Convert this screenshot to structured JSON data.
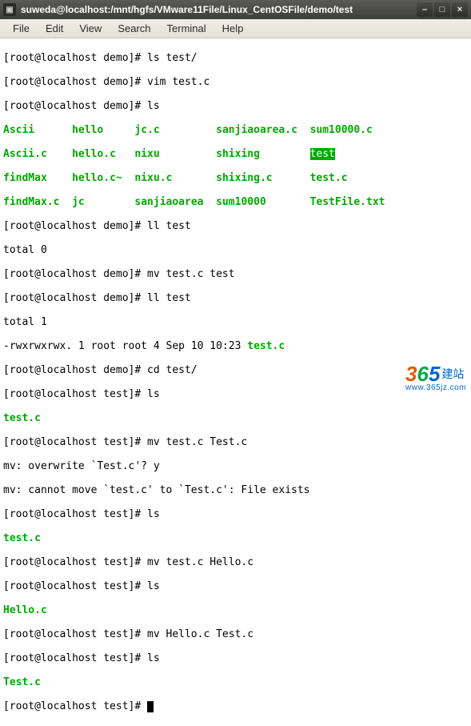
{
  "window": {
    "title": "suweda@localhost:/mnt/hgfs/VMware11File/Linux_CentOSFile/demo/test"
  },
  "menubar": {
    "items": [
      "File",
      "Edit",
      "View",
      "Search",
      "Terminal",
      "Help"
    ]
  },
  "term": {
    "p_demo": "[root@localhost demo]#",
    "p_test": "[root@localhost test]#",
    "cmd01": " ls test/",
    "cmd02": " vim test.c",
    "cmd03": " ls",
    "ls1a": "Ascii",
    "ls1b": "hello",
    "ls1c": "jc.c",
    "ls1d": "sanjiaoarea.c",
    "ls1e": "sum10000.c",
    "ls2a": "Ascii.c",
    "ls2b": "hello.c",
    "ls2c": "nixu",
    "ls2d": "shixing",
    "ls2e": "test",
    "ls3a": "findMax",
    "ls3b": "hello.c~",
    "ls3c": "nixu.c",
    "ls3d": "shixing.c",
    "ls3e": "test.c",
    "ls4a": "findMax.c",
    "ls4b": "jc",
    "ls4c": "sanjiaoarea",
    "ls4d": "sum10000",
    "ls4e": "TestFile.txt",
    "cmd04": " ll test",
    "total0": "total 0",
    "cmd05": " mv test.c test",
    "cmd06": " ll test",
    "total1": "total 1",
    "llline": "-rwxrwxrwx. 1 root root 4 Sep 10 10:23 ",
    "lltarget": "test.c",
    "cmd07": " cd test/",
    "cmd08": " ls",
    "testc": "test.c",
    "cmd09": " mv test.c Test.c",
    "mv1": "mv: overwrite `Test.c'? y",
    "mv2": "mv: cannot move `test.c' to `Test.c': File exists",
    "cmd10": " ls",
    "cmd11": " mv test.c Hello.c",
    "cmd12": " ls",
    "helloc": "Hello.c",
    "cmd13": " mv Hello.c Test.c",
    "cmd14": " ls",
    "Testc": "Test.c",
    "cmd15": " "
  },
  "watermark": {
    "d3": "3",
    "d6": "6",
    "d5": "5",
    "text": "建站",
    "sub": "www.365jz.com"
  }
}
